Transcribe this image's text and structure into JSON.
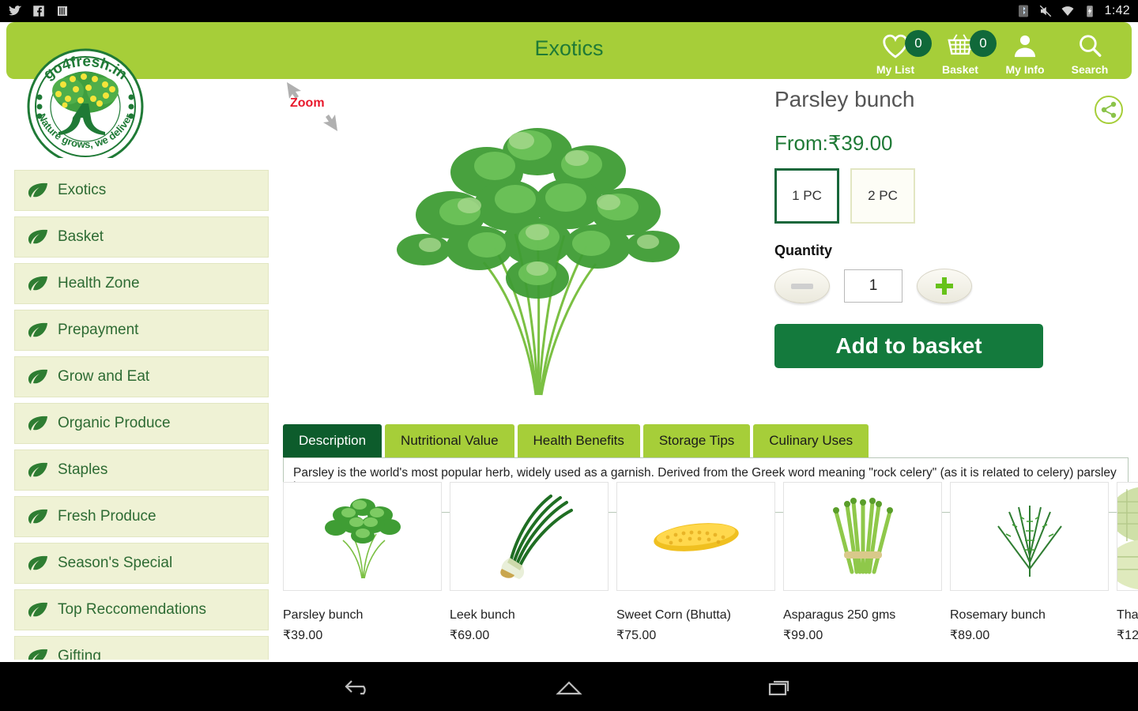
{
  "status_bar": {
    "time": "1:42",
    "icons": [
      "twitter-icon",
      "facebook-icon",
      "app-icon",
      "bluetooth-icon",
      "mute-icon",
      "wifi-icon",
      "battery-charging-icon"
    ]
  },
  "header": {
    "title": "Exotics",
    "bg_color": "#a6ce39",
    "actions": [
      {
        "label": "My List",
        "icon": "heart-icon",
        "badge": "0"
      },
      {
        "label": "Basket",
        "icon": "basket-icon",
        "badge": "0"
      },
      {
        "label": "My Info",
        "icon": "user-icon",
        "badge": ""
      },
      {
        "label": "Search",
        "icon": "search-icon",
        "badge": ""
      }
    ]
  },
  "logo": {
    "brand": "go4fresh.in",
    "tagline": "Nature grows, we deliver"
  },
  "sidebar": {
    "items": [
      {
        "label": "Exotics"
      },
      {
        "label": "Basket"
      },
      {
        "label": "Health Zone"
      },
      {
        "label": "Prepayment"
      },
      {
        "label": "Grow and Eat"
      },
      {
        "label": "Organic Produce"
      },
      {
        "label": "Staples"
      },
      {
        "label": "Fresh Produce"
      },
      {
        "label": "Season's Special"
      },
      {
        "label": "Top Reccomendations"
      },
      {
        "label": "Gifting"
      }
    ]
  },
  "product": {
    "zoom_hint": "Zoom",
    "image_alt": "parsley-bunch-photo",
    "title": "Parsley bunch",
    "price_prefix": "From:",
    "price": "₹39.00",
    "share_icon": "share-icon",
    "packs": [
      {
        "label": "1 PC",
        "selected": true
      },
      {
        "label": "2 PC",
        "selected": false
      }
    ],
    "quantity_label": "Quantity",
    "quantity_value": "1",
    "decrement_label": "−",
    "increment_label": "+",
    "add_button": "Add to basket"
  },
  "tabs": {
    "items": [
      {
        "label": "Description",
        "active": true
      },
      {
        "label": "Nutritional Value",
        "active": false
      },
      {
        "label": "Health Benefits",
        "active": false
      },
      {
        "label": "Storage Tips",
        "active": false
      },
      {
        "label": "Culinary Uses",
        "active": false
      }
    ],
    "panel_text": "Parsley is the world's most popular herb, widely used as a garnish. Derived from the Greek word meaning \"rock celery\" (as it is related to celery) parsley has"
  },
  "carousel": {
    "items": [
      {
        "name": "Parsley bunch",
        "price": "₹39.00",
        "image": "parsley-thumb"
      },
      {
        "name": "Leek bunch",
        "price": "₹69.00",
        "image": "leek-thumb"
      },
      {
        "name": "Sweet Corn (Bhutta)",
        "price": "₹75.00",
        "image": "corn-thumb"
      },
      {
        "name": "Asparagus 250 gms",
        "price": "₹99.00",
        "image": "asparagus-thumb"
      },
      {
        "name": "Rosemary bunch",
        "price": "₹89.00",
        "image": "rosemary-thumb"
      },
      {
        "name": "Tha",
        "price": "₹12",
        "image": "thai-thumb"
      }
    ]
  },
  "nav_bar": {
    "buttons": [
      "back-icon",
      "home-icon",
      "recents-icon"
    ]
  },
  "colors": {
    "brand_light_green": "#a6ce39",
    "brand_dark_green": "#147a3d",
    "sidebar_cream": "#eff2d5",
    "accent_red": "#e8192c"
  }
}
